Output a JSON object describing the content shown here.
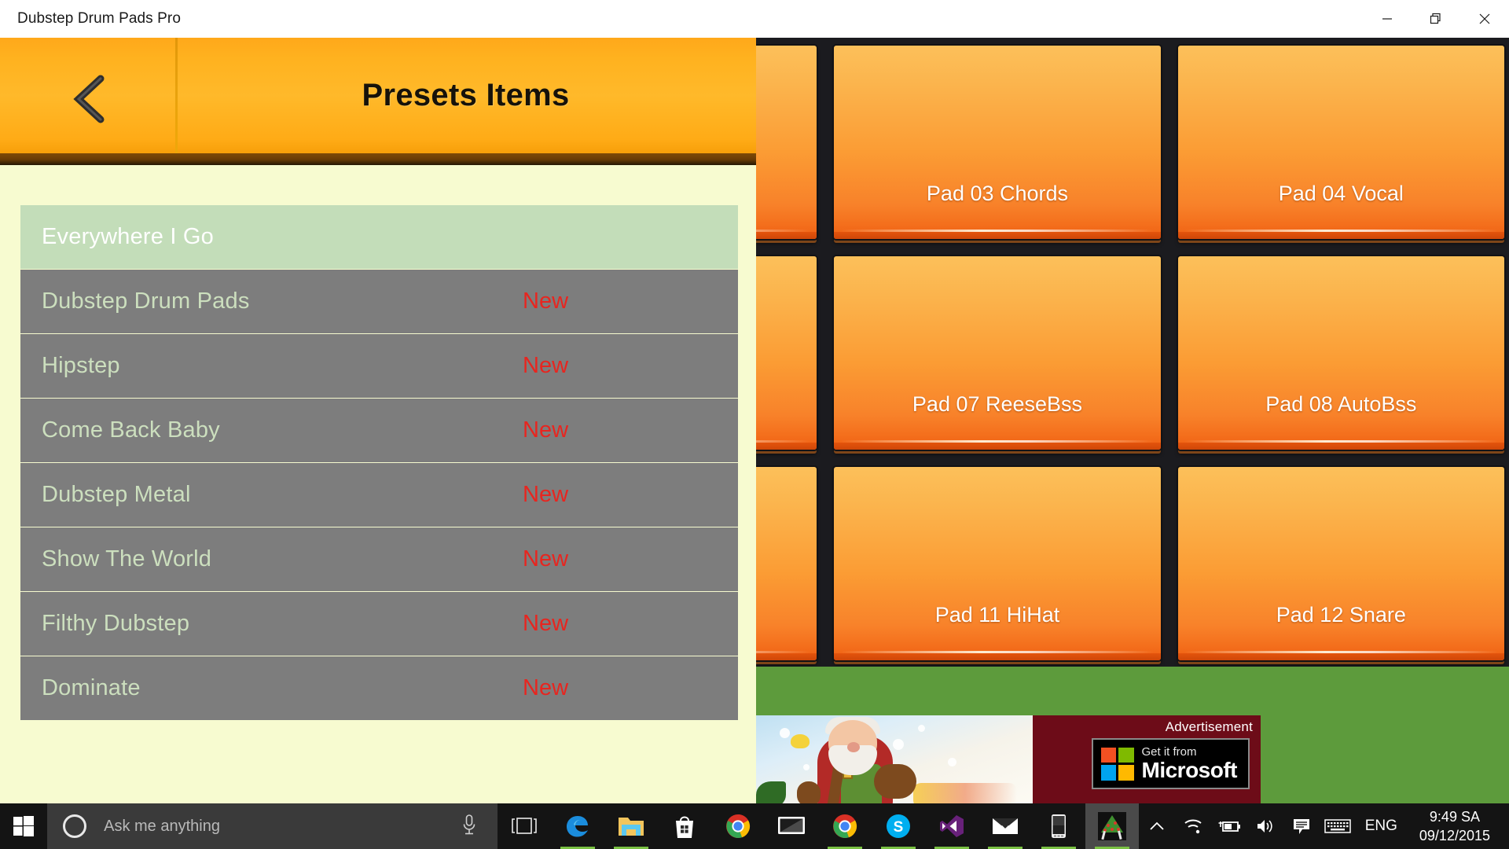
{
  "window": {
    "title": "Dubstep Drum Pads Pro",
    "controls": [
      {
        "name": "minimize-button",
        "icon": "minimize-icon"
      },
      {
        "name": "restore-button",
        "icon": "restore-icon"
      },
      {
        "name": "close-button",
        "icon": "close-icon"
      }
    ]
  },
  "presets": {
    "header": {
      "title": "Presets Items",
      "back_icon": "chevron-left-icon"
    },
    "items": [
      {
        "name": "Everywhere I Go",
        "badge": "",
        "selected": true
      },
      {
        "name": "Dubstep Drum Pads",
        "badge": "New",
        "selected": false
      },
      {
        "name": "Hipstep",
        "badge": "New",
        "selected": false
      },
      {
        "name": "Come Back Baby",
        "badge": "New",
        "selected": false
      },
      {
        "name": "Dubstep Metal",
        "badge": "New",
        "selected": false
      },
      {
        "name": "Show The World",
        "badge": "New",
        "selected": false
      },
      {
        "name": "Filthy Dubstep",
        "badge": "New",
        "selected": false
      },
      {
        "name": "Dominate",
        "badge": "New",
        "selected": false
      }
    ]
  },
  "pads": [
    {
      "label": ""
    },
    {
      "label": "Pad 03 Chords"
    },
    {
      "label": "Pad 04 Vocal"
    },
    {
      "label": ""
    },
    {
      "label": "Pad 07 ReeseBss"
    },
    {
      "label": "Pad 08 AutoBss"
    },
    {
      "label": ""
    },
    {
      "label": "Pad 11 HiHat"
    },
    {
      "label": "Pad 12 Snare"
    }
  ],
  "advertisement": {
    "label": "Advertisement",
    "badge_line1": "Get it from",
    "badge_line2": "Microsoft",
    "badge_colors": [
      "#f25022",
      "#7fba00",
      "#00a4ef",
      "#ffb900"
    ]
  },
  "taskbar": {
    "start_icon": "windows-logo-icon",
    "search": {
      "placeholder": "Ask me anything",
      "cortana_icon": "cortana-circle-icon",
      "mic_icon": "microphone-icon"
    },
    "items": [
      {
        "name": "task-view",
        "icon": "task-view-icon",
        "running": false,
        "active": false
      },
      {
        "name": "edge",
        "icon": "edge-icon",
        "running": true,
        "active": false
      },
      {
        "name": "file-explorer",
        "icon": "folder-icon",
        "running": true,
        "active": false
      },
      {
        "name": "store",
        "icon": "store-bag-icon",
        "running": false,
        "active": false
      },
      {
        "name": "chrome",
        "icon": "chrome-icon",
        "running": false,
        "active": false
      },
      {
        "name": "remote-display",
        "icon": "monitor-icon",
        "running": false,
        "active": false
      },
      {
        "name": "chrome-2",
        "icon": "chrome-icon",
        "running": true,
        "active": false
      },
      {
        "name": "skype",
        "icon": "skype-icon",
        "running": true,
        "active": false
      },
      {
        "name": "visual-studio",
        "icon": "visual-studio-icon",
        "running": true,
        "active": false
      },
      {
        "name": "mail",
        "icon": "mail-envelope-icon",
        "running": true,
        "active": false
      },
      {
        "name": "phone",
        "icon": "phone-icon",
        "running": true,
        "active": false
      },
      {
        "name": "dubstep-drum-pads",
        "icon": "app-tile-icon",
        "running": true,
        "active": true
      }
    ],
    "tray": {
      "overflow_icon": "chevron-up-icon",
      "wifi_icon": "wifi-icon",
      "battery_icon": "battery-charging-icon",
      "volume_icon": "speaker-icon",
      "action_center_icon": "action-center-icon",
      "keyboard_icon": "keyboard-icon",
      "language": "ENG",
      "time": "9:49 SA",
      "date": "09/12/2015"
    }
  },
  "colors": {
    "accent_orange": "#ffb22a",
    "pad_orange": "#fb9c34",
    "list_gray": "#7d7d7d",
    "selected_green": "#c3ddb9",
    "badge_red": "#e8251f",
    "panel_cream": "#f7fbd0",
    "app_green": "#5d9b3c"
  }
}
